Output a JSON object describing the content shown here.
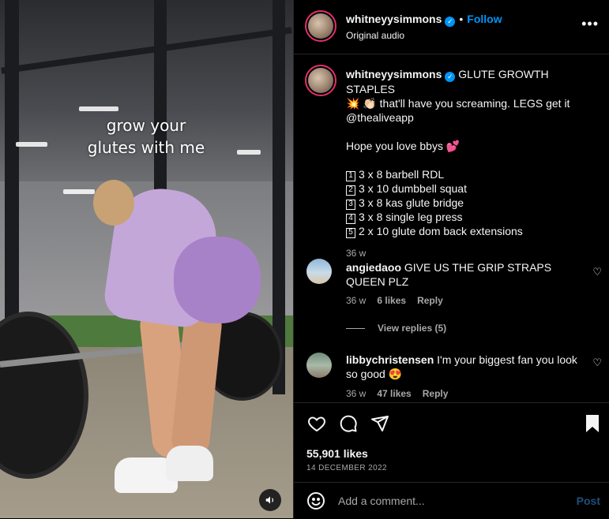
{
  "media": {
    "overlay_line1": "grow your",
    "overlay_line2": "glutes with me",
    "audio_icon": "speaker-icon"
  },
  "header": {
    "username": "whitneyysimmons",
    "separator": "•",
    "follow_label": "Follow",
    "audio_label": "Original audio",
    "more_icon": "more-horizontal-icon"
  },
  "caption": {
    "username": "whitneyysimmons",
    "text_line1": "GLUTE GROWTH STAPLES",
    "text_line2": "💥 👏🏻 that'll have you screaming. LEGS get it",
    "mention": "@thealiveapp",
    "text_line3": "Hope you love bbys 💕",
    "list": [
      {
        "num": "1",
        "text": "3 x 8 barbell RDL"
      },
      {
        "num": "2",
        "text": "3 x 10 dumbbell squat"
      },
      {
        "num": "3",
        "text": "3 x 8 kas glute bridge"
      },
      {
        "num": "4",
        "text": "3 x 8 single leg press"
      },
      {
        "num": "5",
        "text": "2 x 10 glute dom back extensions"
      }
    ],
    "time": "36 w"
  },
  "comments": [
    {
      "username": "angiedaoo",
      "text": "GIVE US THE GRIP STRAPS QUEEN PLZ",
      "time": "36 w",
      "likes": "6 likes",
      "reply": "Reply",
      "view_replies": "View replies (5)"
    },
    {
      "username": "libbychristensen",
      "text": "I'm your biggest fan you look so good 😍",
      "time": "36 w",
      "likes": "47 likes",
      "reply": "Reply"
    }
  ],
  "actions": {
    "likes_count": "55,901 likes",
    "date": "14 DECEMBER 2022"
  },
  "add_comment": {
    "placeholder": "Add a comment...",
    "post_label": "Post"
  },
  "colors": {
    "accent": "#0095f6",
    "background": "#000000",
    "muted": "#a8a8a8"
  }
}
